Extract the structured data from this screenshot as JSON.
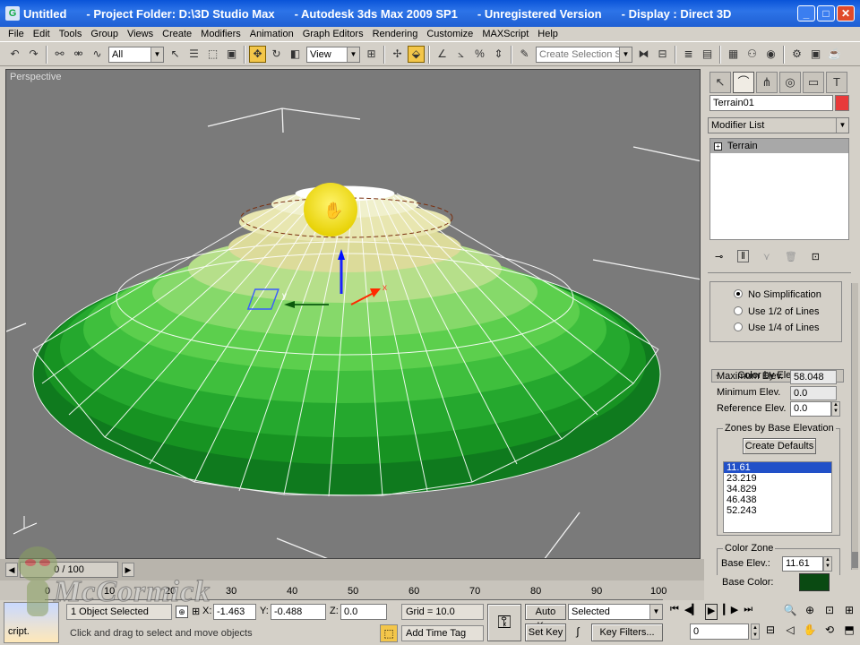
{
  "title": {
    "doc": "Untitled",
    "project": "- Project Folder: D:\\3D Studio Max",
    "app": "- Autodesk 3ds Max  2009 SP1",
    "license": "- Unregistered Version",
    "display": "- Display : Direct 3D"
  },
  "menu": [
    "File",
    "Edit",
    "Tools",
    "Group",
    "Views",
    "Create",
    "Modifiers",
    "Animation",
    "Graph Editors",
    "Rendering",
    "Customize",
    "MAXScript",
    "Help"
  ],
  "toolbar": {
    "filter": "All",
    "coord_system": "View",
    "selection_set_placeholder": "Create Selection Set"
  },
  "viewport": {
    "label": "Perspective",
    "gizmo_x": "x",
    "gizmo_y": "y"
  },
  "panel": {
    "object_name": "Terrain01",
    "object_color": "#e83a3a",
    "modifier_list": "Modifier List",
    "stack_item": "Terrain",
    "simplification": {
      "opt1": "No Simplification",
      "opt2": "Use 1/2 of Lines",
      "opt3": "Use 1/4 of Lines",
      "selected": "No Simplification"
    },
    "color_rollout": {
      "title": "Color by Elevation",
      "max_label": "Maximum Elev.",
      "max_value": "58.048",
      "min_label": "Minimum Elev.",
      "min_value": "0.0",
      "ref_label": "Reference Elev.",
      "ref_value": "0.0",
      "zones_title": "Zones by Base Elevation",
      "create_defaults": "Create Defaults",
      "zones": [
        "11.61",
        "23.219",
        "34.829",
        "46.438",
        "52.243"
      ],
      "selected_zone": "11.61",
      "color_zone_title": "Color Zone",
      "base_elev_label": "Base Elev.:",
      "base_elev_value": "11.61",
      "base_color_label": "Base Color:",
      "base_color": "#0a4a12"
    }
  },
  "timeline": {
    "frame": "0 / 100",
    "ticks": [
      "0",
      "10",
      "20",
      "30",
      "40",
      "50",
      "60",
      "70",
      "80",
      "90",
      "100"
    ]
  },
  "status": {
    "selection": "1 Object Selected",
    "prompt": "Click and drag to select and move objects",
    "x_label": "X:",
    "x_value": "-1.463",
    "y_label": "Y:",
    "y_value": "-0.488",
    "z_label": "Z:",
    "z_value": "0.0",
    "grid": "Grid = 10.0",
    "add_time_tag": "Add Time Tag",
    "auto_key": "Auto Key",
    "set_key": "Set Key",
    "key_mode": "Selected",
    "key_filters": "Key Filters...",
    "current_frame": "0",
    "maxscript": "cript."
  },
  "watermark": "McCormick"
}
